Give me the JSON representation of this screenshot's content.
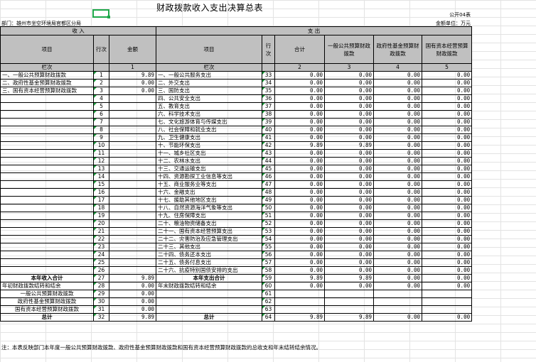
{
  "title": "财政拨款收入支出决算总表",
  "form_no": "公开04表",
  "department": "部门：雄州市坐空环境局官都区分局",
  "unit": "金额单位：万元",
  "note": "注：本表反映部门本年度一般公共预算财政拨款、政府性基金预算财政拨款和国有资本经营预算财政拨款的总收支和年末结转结余情况。",
  "headers": {
    "income": "收    入",
    "expense": "支    出",
    "item": "项目",
    "line": "行次",
    "amount": "金额",
    "item2": "项目",
    "line2": "行次",
    "total": "合计",
    "general": "一般公共预算财政拨款",
    "fund": "政府性基金预算财政拨款",
    "state": "国有资本经营预算财政拨款",
    "col_label": "栏次",
    "col_label2": "栏次",
    "c1": "1",
    "c2": "2",
    "c3": "3",
    "c4": "4",
    "c5": "5"
  },
  "rows": [
    {
      "left": "一、一般公共预算财政拨款",
      "ln": "1",
      "amt": "9.89",
      "right": "一、一般公共服务支出",
      "rln": "33",
      "t": "0.00",
      "g": "0.00",
      "f": "0.00",
      "s": "0.00"
    },
    {
      "left": "二、政府性基金预算财政拨款",
      "ln": "2",
      "amt": "0.00",
      "right": "二、外交支出",
      "rln": "34",
      "t": "0.00",
      "g": "0.00",
      "f": "0.00",
      "s": "0.00"
    },
    {
      "left": "三、国有资本经营预算财政拨款",
      "ln": "3",
      "amt": "0.00",
      "right": "三、国防支出",
      "rln": "35",
      "t": "0.00",
      "g": "0.00",
      "f": "0.00",
      "s": "0.00"
    },
    {
      "left": "",
      "ln": "4",
      "amt": "",
      "right": "四、公共安全支出",
      "rln": "36",
      "t": "0.00",
      "g": "0.00",
      "f": "0.00",
      "s": "0.00"
    },
    {
      "left": "",
      "ln": "5",
      "amt": "",
      "right": "五、教育支出",
      "rln": "37",
      "t": "0.00",
      "g": "0.00",
      "f": "0.00",
      "s": "0.00"
    },
    {
      "left": "",
      "ln": "6",
      "amt": "",
      "right": "六、科学技术支出",
      "rln": "38",
      "t": "0.00",
      "g": "0.00",
      "f": "0.00",
      "s": "0.00"
    },
    {
      "left": "",
      "ln": "7",
      "amt": "",
      "right": "七、文化旅游体育与传媒支出",
      "rln": "39",
      "t": "0.00",
      "g": "0.00",
      "f": "0.00",
      "s": "0.00"
    },
    {
      "left": "",
      "ln": "8",
      "amt": "",
      "right": "八、社会保障和就业支出",
      "rln": "40",
      "t": "0.00",
      "g": "0.00",
      "f": "0.00",
      "s": "0.00"
    },
    {
      "left": "",
      "ln": "9",
      "amt": "",
      "right": "九、卫生健康支出",
      "rln": "41",
      "t": "0.00",
      "g": "0.00",
      "f": "0.00",
      "s": "0.00"
    },
    {
      "left": "",
      "ln": "10",
      "amt": "",
      "right": "十、节能环保支出",
      "rln": "42",
      "t": "9.89",
      "g": "9.89",
      "f": "0.00",
      "s": "0.00"
    },
    {
      "left": "",
      "ln": "11",
      "amt": "",
      "right": "十一、城乡社区支出",
      "rln": "43",
      "t": "0.00",
      "g": "0.00",
      "f": "0.00",
      "s": "0.00"
    },
    {
      "left": "",
      "ln": "12",
      "amt": "",
      "right": "十二、农林水支出",
      "rln": "44",
      "t": "0.00",
      "g": "0.00",
      "f": "0.00",
      "s": "0.00"
    },
    {
      "left": "",
      "ln": "13",
      "amt": "",
      "right": "十三、交通运输支出",
      "rln": "45",
      "t": "0.00",
      "g": "0.00",
      "f": "0.00",
      "s": "0.00"
    },
    {
      "left": "",
      "ln": "14",
      "amt": "",
      "right": "十四、资源勘探工业信息等支出",
      "rln": "46",
      "t": "0.00",
      "g": "0.00",
      "f": "0.00",
      "s": "0.00"
    },
    {
      "left": "",
      "ln": "15",
      "amt": "",
      "right": "十五、商业服务业等支出",
      "rln": "47",
      "t": "0.00",
      "g": "0.00",
      "f": "0.00",
      "s": "0.00"
    },
    {
      "left": "",
      "ln": "16",
      "amt": "",
      "right": "十六、金融支出",
      "rln": "48",
      "t": "0.00",
      "g": "0.00",
      "f": "0.00",
      "s": "0.00"
    },
    {
      "left": "",
      "ln": "17",
      "amt": "",
      "right": "十七、援助其他地区支出",
      "rln": "49",
      "t": "0.00",
      "g": "0.00",
      "f": "0.00",
      "s": "0.00"
    },
    {
      "left": "",
      "ln": "18",
      "amt": "",
      "right": "十八、自然资源海洋气象等支出",
      "rln": "50",
      "t": "0.00",
      "g": "0.00",
      "f": "0.00",
      "s": "0.00"
    },
    {
      "left": "",
      "ln": "19",
      "amt": "",
      "right": "十九、住房保障支出",
      "rln": "51",
      "t": "0.00",
      "g": "0.00",
      "f": "0.00",
      "s": "0.00"
    },
    {
      "left": "",
      "ln": "20",
      "amt": "",
      "right": "二十、粮油物资储备支出",
      "rln": "52",
      "t": "0.00",
      "g": "0.00",
      "f": "0.00",
      "s": "0.00"
    },
    {
      "left": "",
      "ln": "21",
      "amt": "",
      "right": "二十一、国有资本经营预算支出",
      "rln": "53",
      "t": "0.00",
      "g": "0.00",
      "f": "0.00",
      "s": "0.00"
    },
    {
      "left": "",
      "ln": "22",
      "amt": "",
      "right": "二十二、灾害防治及应急管理支出",
      "rln": "54",
      "t": "0.00",
      "g": "0.00",
      "f": "0.00",
      "s": "0.00"
    },
    {
      "left": "",
      "ln": "23",
      "amt": "",
      "right": "二十三、其他支出",
      "rln": "55",
      "t": "0.00",
      "g": "0.00",
      "f": "0.00",
      "s": "0.00"
    },
    {
      "left": "",
      "ln": "24",
      "amt": "",
      "right": "二十四、债务还本支出",
      "rln": "56",
      "t": "0.00",
      "g": "0.00",
      "f": "0.00",
      "s": "0.00"
    },
    {
      "left": "",
      "ln": "25",
      "amt": "",
      "right": "二十五、债务付息支出",
      "rln": "57",
      "t": "0.00",
      "g": "0.00",
      "f": "0.00",
      "s": "0.00"
    },
    {
      "left": "",
      "ln": "26",
      "amt": "",
      "right": "二十六、抗疫特别国债安排的支出",
      "rln": "58",
      "t": "0.00",
      "g": "0.00",
      "f": "0.00",
      "s": "0.00"
    },
    {
      "left": "本年收入合计",
      "ln": "27",
      "amt": "9.89",
      "right": "本年支出合计",
      "rln": "59",
      "t": "9.89",
      "g": "9.89",
      "f": "0.00",
      "s": "0.00",
      "bold": true
    },
    {
      "left": "年初财政拨款结转和结余",
      "ln": "28",
      "amt": "0.00",
      "right": "年末财政拨款结转和结余",
      "rln": "60",
      "t": "0.00",
      "g": "0.00",
      "f": "0.00",
      "s": "0.00"
    },
    {
      "left": "一般公共预算财政拨款",
      "ln": "29",
      "amt": "0.00",
      "right": "",
      "rln": "61",
      "t": "",
      "g": "",
      "f": "",
      "s": ""
    },
    {
      "left": "政府性基金预算财政拨款",
      "ln": "30",
      "amt": "0.00",
      "right": "",
      "rln": "62",
      "t": "",
      "g": "",
      "f": "",
      "s": ""
    },
    {
      "left": "国有资本经营预算财政拨款",
      "ln": "31",
      "amt": "0.00",
      "right": "",
      "rln": "63",
      "t": "",
      "g": "",
      "f": "",
      "s": ""
    },
    {
      "left": "总计",
      "ln": "32",
      "amt": "9.89",
      "right": "总计",
      "rln": "64",
      "t": "9.89",
      "g": "9.89",
      "f": "0.00",
      "s": "0.00",
      "bold": true
    }
  ]
}
